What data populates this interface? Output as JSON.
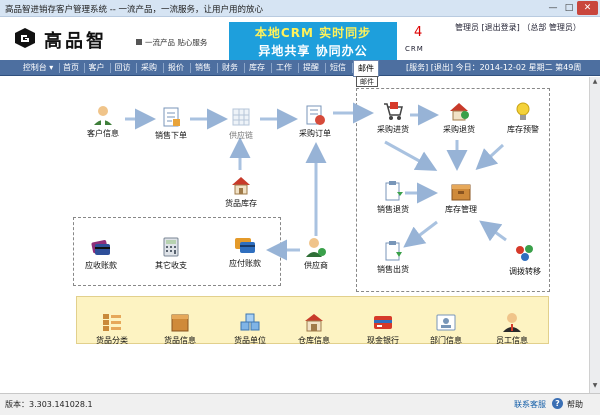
{
  "window": {
    "title": "高品智进销存客户管理系统 -- 一流产品，一流服务，让用户用的放心",
    "min": "—",
    "max": "□",
    "close": "✕"
  },
  "header": {
    "logo_text": "高品智",
    "slogan": "一流产品  贴心服务",
    "banner_line1": "本地CRM 实时同步",
    "banner_line2": "异地共享  协同办公",
    "banner_num": "4",
    "banner_sub": "CRM",
    "user_links": "管理员   [退出登录]   （总部 管理员）"
  },
  "nav": {
    "items": [
      "控制台 ▾",
      "首页",
      "客户",
      "回访",
      "采购",
      "报价",
      "销售",
      "财务",
      "库存",
      "工作",
      "提醒",
      "短信",
      "邮件"
    ],
    "active_index": 12,
    "right_text": "[服务]   [退出]   今日：2014-12-02 星期二  第49周"
  },
  "tooltip": "邮件",
  "flow": {
    "customer_info": "客户信息",
    "sales_order": "销售下单",
    "supply_chain": "供应链",
    "purchase_order": "采购订单",
    "goods_stock": "货品库存",
    "receivable": "应收账款",
    "other_income": "其它收支",
    "payable": "应付账款",
    "supplier": "供应商",
    "purchase_in": "采购进货",
    "purchase_return": "采购退货",
    "stock_alert": "库存预警",
    "sales_return": "销售退货",
    "stock_manage": "库存管理",
    "sales_out": "销售出货",
    "transfer": "调拨转移"
  },
  "base": [
    "货品分类",
    "货品信息",
    "货品单位",
    "仓库信息",
    "现金银行",
    "部门信息",
    "员工信息"
  ],
  "status": {
    "version": "版本：3.303.141028.1",
    "service": "联系客服",
    "help_icon": "?",
    "help": "帮助"
  }
}
